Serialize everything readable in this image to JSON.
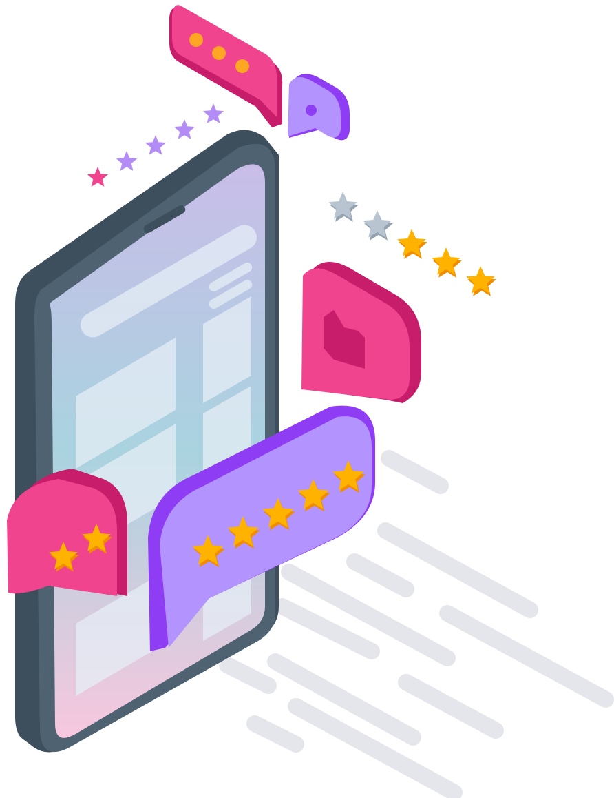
{
  "colors": {
    "background": "#ffffff",
    "phone_frame": "#4f6271",
    "phone_frame_dark": "#3d4e5c",
    "phone_edge": "#6d8291",
    "screen_top": "#c9bde8",
    "screen_mid": "#a9d3df",
    "screen_bottom": "#f7c7de",
    "screen_block": "#e6eef5",
    "bubble_pink": "#f0448e",
    "bubble_pink_dark": "#c81d6b",
    "bubble_purple": "#b394ff",
    "bubble_purple_dark": "#8f3df5",
    "star_gold": "#ffb300",
    "star_gold_dark": "#f08c00",
    "star_gray": "#b8c4cf",
    "star_lavender": "#b38df5",
    "dot_orange": "#ffa624",
    "shadow_lines": "#e5e5ec"
  },
  "illustration": {
    "icons": [
      "smartphone-icon",
      "typing-dots-bubble-icon",
      "small-chat-bubble-icon",
      "thumbs-up-bubble-icon",
      "two-star-bubble-icon",
      "five-star-bubble-icon",
      "rating-stars-lavender-icon",
      "rating-stars-gold-gray-icon"
    ]
  },
  "ratings": {
    "lavender_row": {
      "filled": 1,
      "total": 5
    },
    "gold_row": {
      "filled": 3,
      "total": 5
    },
    "small_bubble": {
      "filled": 2,
      "total": 2
    },
    "big_bubble": {
      "filled": 5,
      "total": 5
    }
  }
}
